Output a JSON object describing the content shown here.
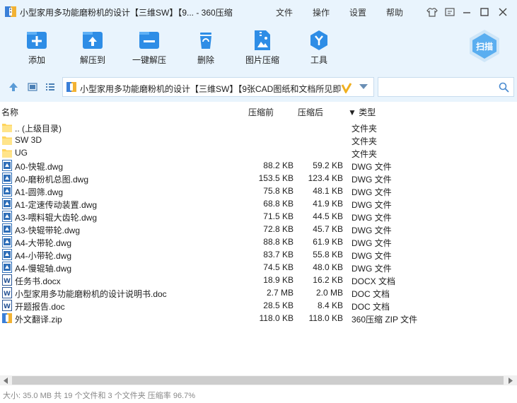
{
  "window": {
    "title": "小型家用多功能磨粉机的设计【三维SW】【9... - 360压缩"
  },
  "menu": [
    "文件",
    "操作",
    "设置",
    "帮助"
  ],
  "toolbar": [
    {
      "label": "添加",
      "icon": "add-icon"
    },
    {
      "label": "解压到",
      "icon": "extract-to-icon"
    },
    {
      "label": "一键解压",
      "icon": "one-click-extract-icon"
    },
    {
      "label": "删除",
      "icon": "delete-icon"
    },
    {
      "label": "图片压缩",
      "icon": "image-compress-icon"
    },
    {
      "label": "工具",
      "icon": "tools-icon"
    }
  ],
  "scan_label": "扫描",
  "path": {
    "text": "小型家用多功能磨粉机的设计【三维SW】【9张CAD图纸和文档所见即"
  },
  "columns": {
    "name": "名称",
    "before": "压缩前",
    "after": "压缩后",
    "type": "▼ 类型"
  },
  "files": [
    {
      "name": ".. (上级目录)",
      "before": "",
      "after": "",
      "type": "文件夹",
      "icon": "folder-icon"
    },
    {
      "name": "SW 3D",
      "before": "",
      "after": "",
      "type": "文件夹",
      "icon": "folder-icon"
    },
    {
      "name": "UG",
      "before": "",
      "after": "",
      "type": "文件夹",
      "icon": "folder-icon"
    },
    {
      "name": "A0-快辊.dwg",
      "before": "88.2 KB",
      "after": "59.2 KB",
      "type": "DWG 文件",
      "icon": "dwg-file-icon"
    },
    {
      "name": "A0-磨粉机总图.dwg",
      "before": "153.5 KB",
      "after": "123.4 KB",
      "type": "DWG 文件",
      "icon": "dwg-file-icon"
    },
    {
      "name": "A1-圆筛.dwg",
      "before": "75.8 KB",
      "after": "48.1 KB",
      "type": "DWG 文件",
      "icon": "dwg-file-icon"
    },
    {
      "name": "A1-定速传动装置.dwg",
      "before": "68.8 KB",
      "after": "41.9 KB",
      "type": "DWG 文件",
      "icon": "dwg-file-icon"
    },
    {
      "name": "A3-喂料辊大齿轮.dwg",
      "before": "71.5 KB",
      "after": "44.5 KB",
      "type": "DWG 文件",
      "icon": "dwg-file-icon"
    },
    {
      "name": "A3-快辊带轮.dwg",
      "before": "72.8 KB",
      "after": "45.7 KB",
      "type": "DWG 文件",
      "icon": "dwg-file-icon"
    },
    {
      "name": "A4-大带轮.dwg",
      "before": "88.8 KB",
      "after": "61.9 KB",
      "type": "DWG 文件",
      "icon": "dwg-file-icon"
    },
    {
      "name": "A4-小带轮.dwg",
      "before": "83.7 KB",
      "after": "55.8 KB",
      "type": "DWG 文件",
      "icon": "dwg-file-icon"
    },
    {
      "name": "A4-慢辊轴.dwg",
      "before": "74.5 KB",
      "after": "48.0 KB",
      "type": "DWG 文件",
      "icon": "dwg-file-icon"
    },
    {
      "name": "任务书.docx",
      "before": "18.9 KB",
      "after": "16.2 KB",
      "type": "DOCX 文档",
      "icon": "word-file-icon"
    },
    {
      "name": "小型家用多功能磨粉机的设计说明书.doc",
      "before": "2.7 MB",
      "after": "2.0 MB",
      "type": "DOC 文档",
      "icon": "word-file-icon"
    },
    {
      "name": "开题报告.doc",
      "before": "28.5 KB",
      "after": "8.4 KB",
      "type": "DOC 文档",
      "icon": "word-file-icon"
    },
    {
      "name": "外文翻译.zip",
      "before": "118.0 KB",
      "after": "118.0 KB",
      "type": "360压缩 ZIP 文件",
      "icon": "zip-file-icon"
    }
  ],
  "status": "大小: 35.0 MB 共 19 个文件和 3 个文件夹 压缩率 96.7%"
}
